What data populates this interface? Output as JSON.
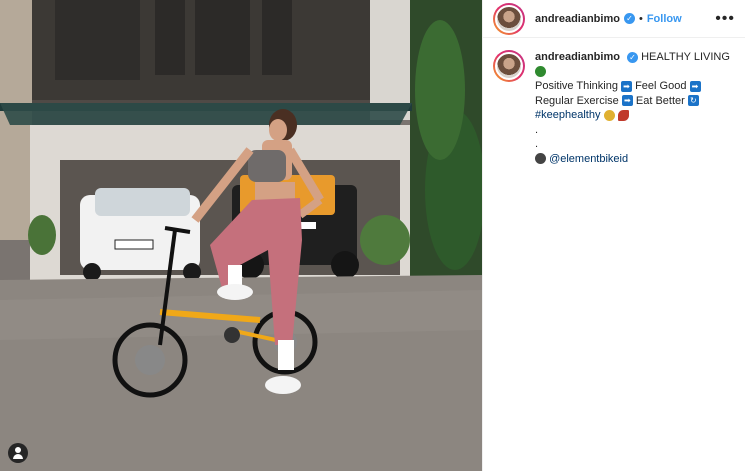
{
  "post": {
    "username": "andreadianbimo",
    "follow_label": "Follow",
    "dot_separator": "•",
    "more_label": "•••",
    "verified_symbol": "✓"
  },
  "caption": {
    "username": "andreadianbimo",
    "headline": "HEALTHY LIVING",
    "line_emoji": "green-leaf-emoji",
    "line1_a": "Positive Thinking",
    "line1_b": "Feel Good",
    "line2_a": "Regular Exercise",
    "line2_b": "Eat Better",
    "hashtag": "#keephealthy",
    "dot1": ".",
    "dot2": ".",
    "mention": "@elementbikeid",
    "arrow_symbol": "➡",
    "refresh_symbol": "🔄"
  },
  "colors": {
    "accent": "#3897f0",
    "link": "#003569",
    "text": "#262626",
    "border": "#efefef"
  }
}
